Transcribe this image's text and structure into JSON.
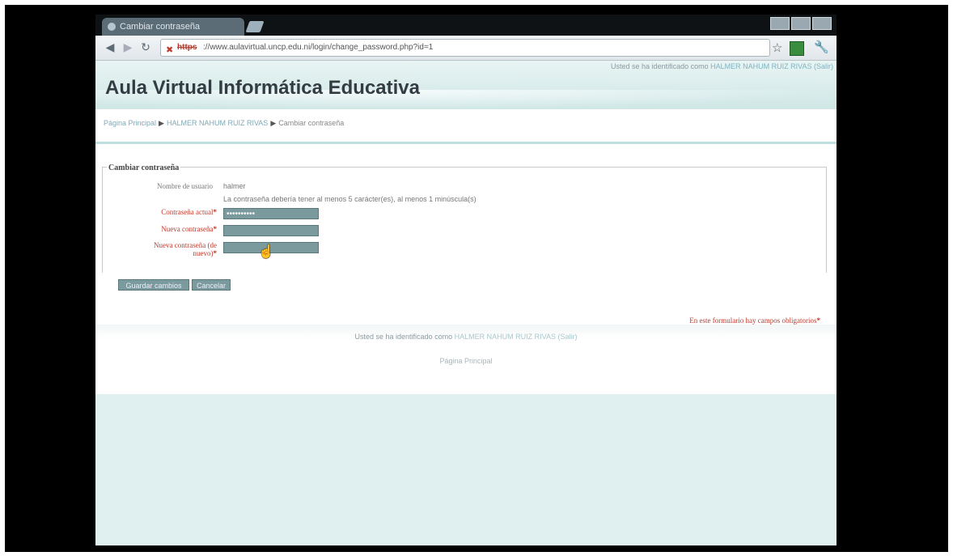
{
  "browser": {
    "tab_title": "Cambiar contraseña",
    "url_scheme": "https",
    "url": "://www.aulavirtual.uncp.edu.ni/login/change_password.php?id=1"
  },
  "header": {
    "login_info_prefix": "Usted se ha identificado como",
    "login_user": "HALMER NAHUM RUIZ RIVAS",
    "login_logout": "(Salir)",
    "site_title": "Aula Virtual Informática Educativa"
  },
  "breadcrumb": {
    "home": "Página Principal",
    "user": "HALMER NAHUM RUIZ RIVAS",
    "current": "Cambiar contraseña"
  },
  "form": {
    "legend": "Cambiar contraseña",
    "username_label": "Nombre de usuario",
    "username_value": "halmer",
    "rules_text": "La contraseña debería tener al menos 5 carácter(es), al menos 1 minúscula(s)",
    "current_password_label": "Contraseña actual",
    "current_password_value": "••••••••••",
    "new_password_label": "Nueva contraseña",
    "new_password_again_label_1": "Nueva contraseña (de",
    "new_password_again_label_2": "nuevo)",
    "required_mark": "*",
    "save_button": "Guardar cambios",
    "cancel_button": "Cancelar",
    "required_note": "En este formulario hay campos obligatorios"
  },
  "footer": {
    "login_prefix": "Usted se ha identificado como",
    "login_user": "HALMER NAHUM RUIZ RIVAS",
    "logout": "(Salir)",
    "home_link": "Página Principal"
  },
  "icons": {
    "back": "back-arrow-icon",
    "forward": "forward-arrow-icon",
    "reload": "reload-icon",
    "bookmark": "star-icon",
    "settings": "wrench-icon"
  }
}
